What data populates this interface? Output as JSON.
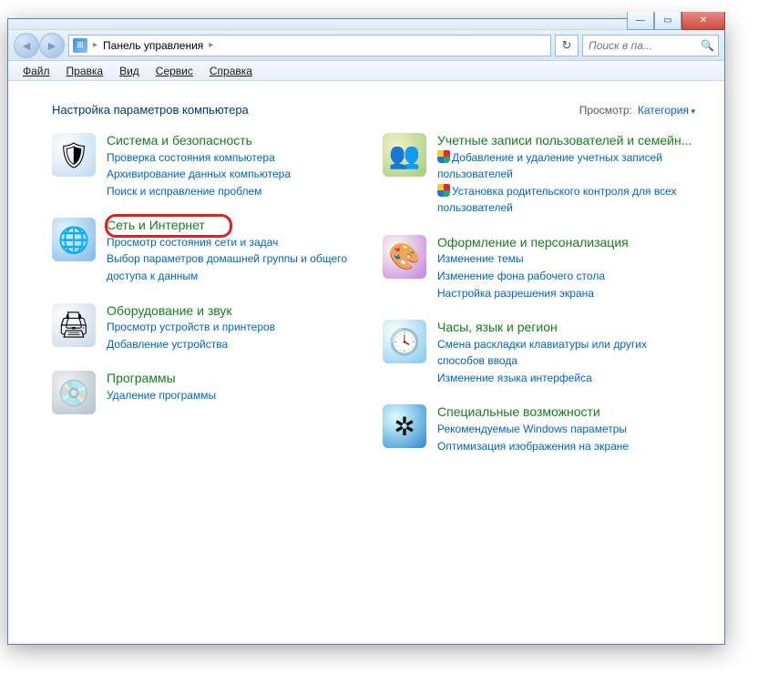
{
  "breadcrumb": {
    "root_label": "Панель управления"
  },
  "search": {
    "placeholder": "Поиск в па..."
  },
  "menu": {
    "file": "Файл",
    "edit": "Правка",
    "view": "Вид",
    "tools": "Сервис",
    "help": "Справка"
  },
  "heading": "Настройка параметров компьютера",
  "view_by": {
    "label": "Просмотр:",
    "value": "Категория"
  },
  "left": [
    {
      "title": "Система и безопасность",
      "links": [
        "Проверка состояния компьютера",
        "Архивирование данных компьютера",
        "Поиск и исправление проблем"
      ],
      "icon_cls": "ic-system",
      "glyph": "🛡"
    },
    {
      "title": "Сеть и Интернет",
      "links": [
        "Просмотр состояния сети и задач",
        "Выбор параметров домашней группы и общего доступа к данным"
      ],
      "icon_cls": "ic-network",
      "glyph": "🌐",
      "highlight": true
    },
    {
      "title": "Оборудование и звук",
      "links": [
        "Просмотр устройств и принтеров",
        "Добавление устройства"
      ],
      "icon_cls": "ic-hardware",
      "glyph": "🖨"
    },
    {
      "title": "Программы",
      "links": [
        "Удаление программы"
      ],
      "icon_cls": "ic-programs",
      "glyph": "💿"
    }
  ],
  "right": [
    {
      "title": "Учетные записи пользователей и семейн...",
      "links": [
        {
          "text": "Добавление и удаление учетных записей пользователей",
          "shield": true
        },
        {
          "text": "Установка родительского контроля для всех пользователей",
          "shield": true
        }
      ],
      "icon_cls": "ic-users",
      "glyph": "👥"
    },
    {
      "title": "Оформление и персонализация",
      "links": [
        "Изменение темы",
        "Изменение фона рабочего стола",
        "Настройка разрешения экрана"
      ],
      "icon_cls": "ic-appear",
      "glyph": "🎨"
    },
    {
      "title": "Часы, язык и регион",
      "links": [
        "Смена раскладки клавиатуры или других способов ввода",
        "Изменение языка интерфейса"
      ],
      "icon_cls": "ic-clock",
      "glyph": "🕓"
    },
    {
      "title": "Специальные возможности",
      "links": [
        "Рекомендуемые Windows параметры",
        "Оптимизация изображения на экране"
      ],
      "icon_cls": "ic-access",
      "glyph": "✲"
    }
  ]
}
